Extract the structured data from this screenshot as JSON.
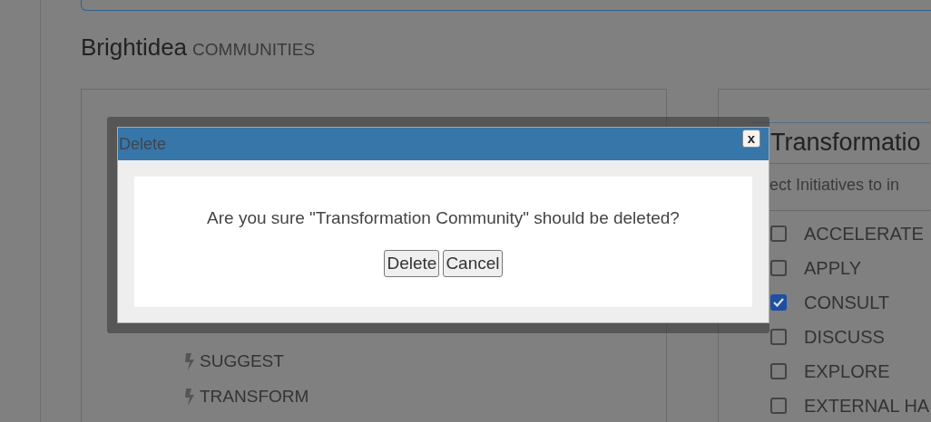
{
  "header": {
    "brand": "Brightidea",
    "section": "COMMUNITIES"
  },
  "left_panel": {
    "items": [
      {
        "label": "SUGGEST"
      },
      {
        "label": "TRANSFORM"
      }
    ]
  },
  "right_panel": {
    "title": "Transformatio",
    "instruction": "ect Initiatives to in",
    "initiatives": [
      {
        "label": "ACCELERATE",
        "checked": false
      },
      {
        "label": "APPLY",
        "checked": false
      },
      {
        "label": "CONSULT",
        "checked": true
      },
      {
        "label": "DISCUSS",
        "checked": false
      },
      {
        "label": "EXPLORE",
        "checked": false
      },
      {
        "label": "EXTERNAL HA",
        "checked": false
      }
    ]
  },
  "dialog": {
    "title": "Delete",
    "close": "x",
    "message": "Are you sure \"Transformation Community\" should be deleted?",
    "buttons": [
      "Delete",
      "Cancel"
    ]
  }
}
